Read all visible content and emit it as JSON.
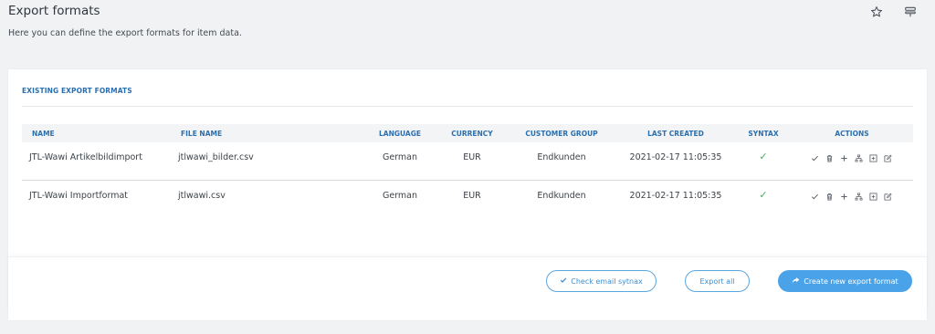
{
  "page": {
    "title": "Export formats",
    "subtitle": "Here you can define the export formats for item data."
  },
  "top_icons": [
    "star-icon",
    "layout-icon"
  ],
  "card": {
    "header": "EXISTING EXPORT FORMATS"
  },
  "table": {
    "columns": [
      "NAME",
      "FILE NAME",
      "LANGUAGE",
      "CURRENCY",
      "CUSTOMER GROUP",
      "LAST CREATED",
      "SYNTAX",
      "ACTIONS"
    ],
    "rows": [
      {
        "name": "JTL-Wawi Artikelbildimport",
        "file_name": "jtlwawi_bilder.csv",
        "language": "German",
        "currency": "EUR",
        "customer_group": "Endkunden",
        "last_created": "2021-02-17 11:05:35",
        "syntax": "✓"
      },
      {
        "name": "JTL-Wawi Importformat",
        "file_name": "jtlwawi.csv",
        "language": "German",
        "currency": "EUR",
        "customer_group": "Endkunden",
        "last_created": "2021-02-17 11:05:35",
        "syntax": "✓"
      }
    ],
    "action_icons": [
      "check-icon",
      "trash-icon",
      "plus-icon",
      "sitemap-icon",
      "add-box-icon",
      "edit-icon"
    ]
  },
  "footer": {
    "check_email_syntax": "Check email sytnax",
    "export_all": "Export all",
    "create_new": "Create new export format"
  },
  "colors": {
    "accent": "#2b6fae",
    "primary_button": "#4aa3e8",
    "success": "#3fae5a",
    "background": "#f1f2f4"
  }
}
